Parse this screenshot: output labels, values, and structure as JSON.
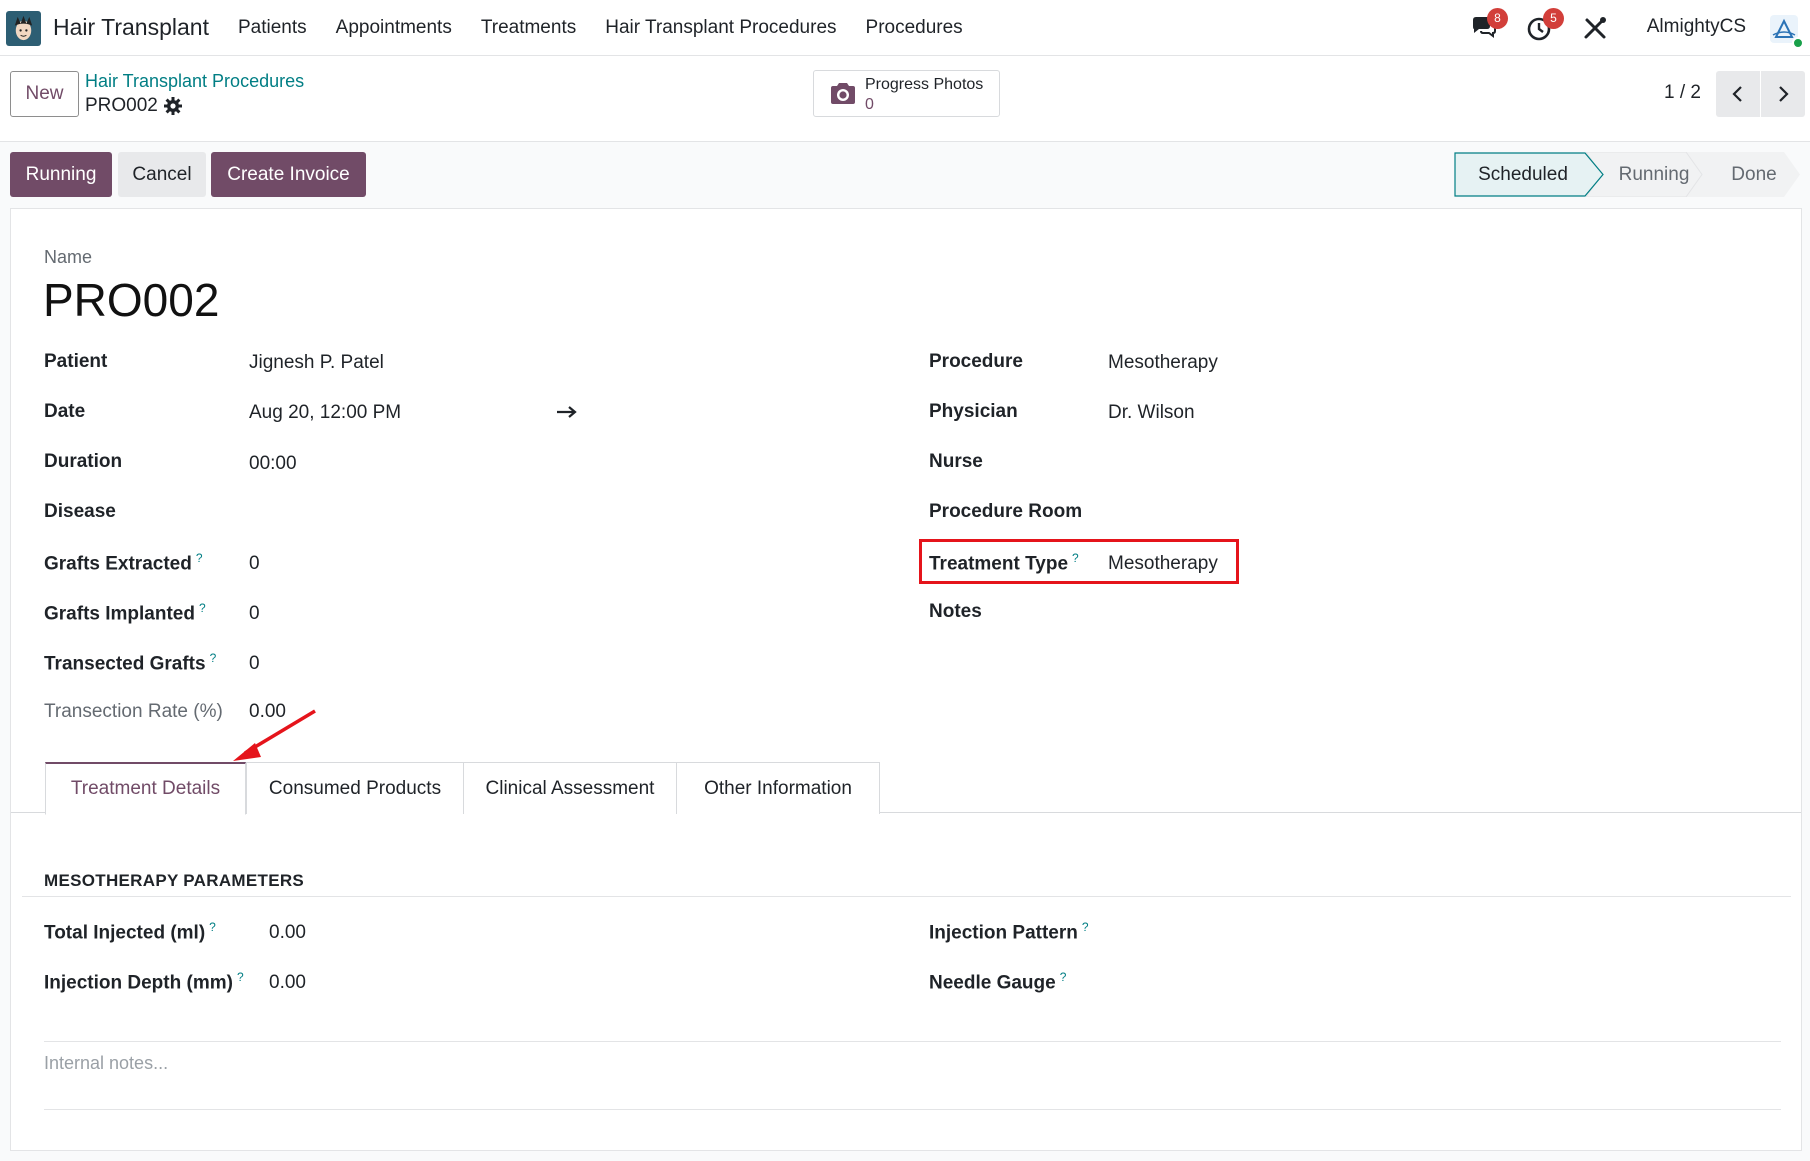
{
  "navbar": {
    "app_name": "Hair Transplant",
    "menu": [
      "Patients",
      "Appointments",
      "Treatments",
      "Hair Transplant Procedures",
      "Procedures"
    ],
    "messages_count": "8",
    "activities_count": "5",
    "company": "AlmightyCS"
  },
  "control": {
    "new_label": "New",
    "breadcrumb_parent": "Hair Transplant Procedures",
    "breadcrumb_current": "PRO002",
    "smart_button": {
      "label": "Progress Photos",
      "count": "0"
    },
    "pager": "1 / 2"
  },
  "status": {
    "buttons": [
      "Running",
      "Cancel",
      "Create Invoice"
    ],
    "stages": [
      "Scheduled",
      "Running",
      "Done"
    ],
    "current_stage": "Scheduled"
  },
  "form": {
    "name_label": "Name",
    "name": "PRO002",
    "left": [
      {
        "label": "Patient",
        "value": "Jignesh P. Patel",
        "help": false
      },
      {
        "label": "Date",
        "value": "Aug 20, 12:00 PM",
        "help": false
      },
      {
        "label": "Duration",
        "value": "00:00",
        "help": false
      },
      {
        "label": "Disease",
        "value": "",
        "help": false
      },
      {
        "label": "Grafts Extracted",
        "value": "0",
        "help": true
      },
      {
        "label": "Grafts Implanted",
        "value": "0",
        "help": true
      },
      {
        "label": "Transected Grafts",
        "value": "0",
        "help": true
      },
      {
        "label": "Transection Rate (%)",
        "value": "0.00",
        "help": false
      }
    ],
    "right": [
      {
        "label": "Procedure",
        "value": "Mesotherapy",
        "help": false
      },
      {
        "label": "Physician",
        "value": "Dr. Wilson",
        "help": false
      },
      {
        "label": "Nurse",
        "value": "",
        "help": false
      },
      {
        "label": "Procedure Room",
        "value": "",
        "help": false
      },
      {
        "label": "Treatment Type",
        "value": "Mesotherapy",
        "help": true
      },
      {
        "label": "Notes",
        "value": "",
        "help": false
      }
    ],
    "help_mark": "?"
  },
  "tabs": [
    "Treatment Details",
    "Consumed Products",
    "Clinical Assessment",
    "Other Information"
  ],
  "details": {
    "section_title": "MESOTHERAPY PARAMETERS",
    "left": [
      {
        "label": "Total Injected (ml)",
        "value": "0.00"
      },
      {
        "label": "Injection Depth (mm)",
        "value": "0.00"
      }
    ],
    "right": [
      {
        "label": "Injection Pattern",
        "value": ""
      },
      {
        "label": "Needle Gauge",
        "value": ""
      }
    ],
    "notes_placeholder": "Internal notes..."
  },
  "colors": {
    "brand": "#714b67",
    "link": "#017e84",
    "annotation": "#e5141b",
    "badge": "#d23f3a"
  }
}
